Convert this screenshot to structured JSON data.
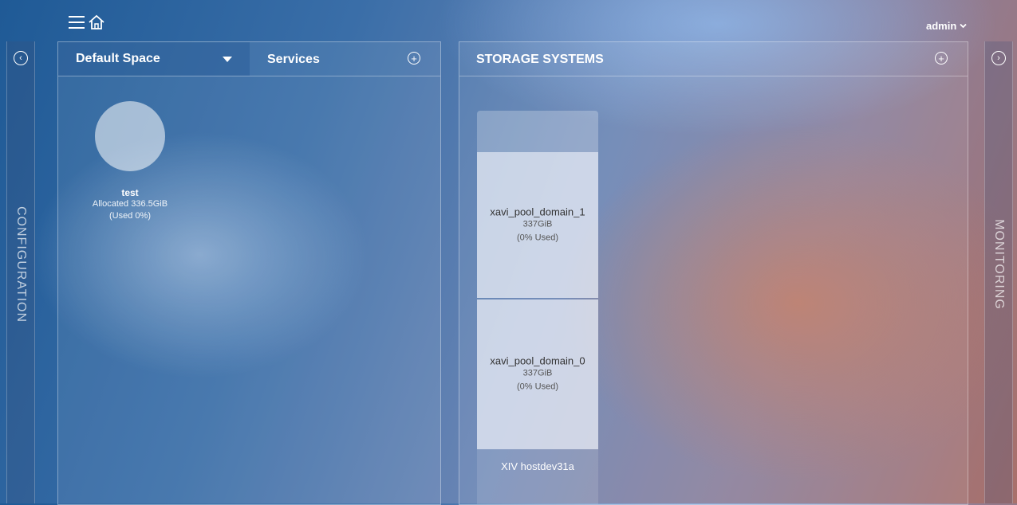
{
  "header": {
    "user": "admin"
  },
  "left_rail": {
    "label": "CONFIGURATION",
    "toggle_icon": "chevron-left-circle-icon"
  },
  "right_rail": {
    "label": "MONITORING",
    "toggle_icon": "chevron-right-circle-icon"
  },
  "spaces_panel": {
    "space_selector": "Default Space",
    "tab_label": "Services",
    "add_icon": "plus-circle-icon",
    "services": [
      {
        "name": "test",
        "allocated": "Allocated 336.5GiB",
        "used": "(Used 0%)"
      }
    ]
  },
  "storage_panel": {
    "title": "STORAGE SYSTEMS",
    "add_icon": "plus-circle-icon",
    "systems": [
      {
        "name": "XIV hostdev31a",
        "pools": [
          {
            "name": "xavi_pool_domain_1",
            "size": "337GiB",
            "used": "(0% Used)"
          },
          {
            "name": "xavi_pool_domain_0",
            "size": "337GiB",
            "used": "(0% Used)"
          }
        ]
      }
    ]
  }
}
